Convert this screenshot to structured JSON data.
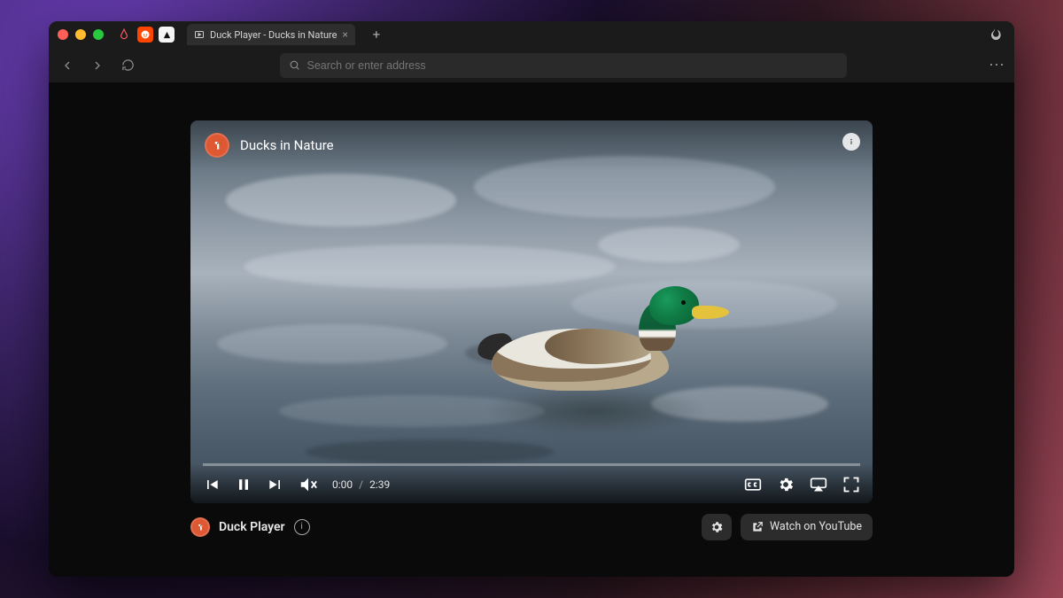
{
  "window": {
    "tab_title": "Duck Player - Ducks in Nature",
    "pinned_icons": [
      "airbnb",
      "reddit",
      "ramp"
    ]
  },
  "toolbar": {
    "search_placeholder": "Search or enter address"
  },
  "video": {
    "title": "Ducks in Nature"
  },
  "playback": {
    "current": "0:00",
    "duration": "2:39",
    "separator": "/",
    "progress_percent": 0
  },
  "footer": {
    "brand": "Duck Player",
    "watch_label": "Watch on YouTube"
  }
}
